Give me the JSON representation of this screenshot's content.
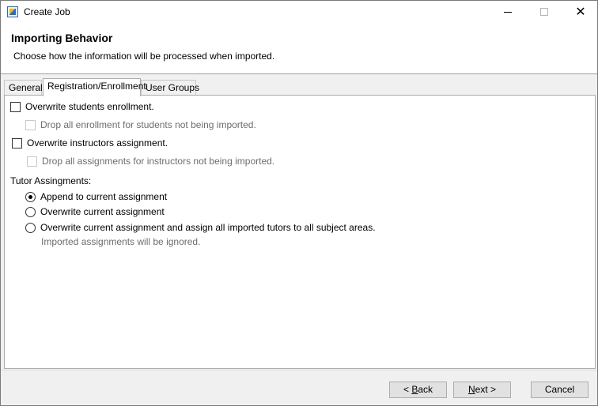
{
  "window": {
    "title": "Create Job",
    "app_icon": "report-wizard-icon",
    "controls": {
      "minimize": "minimize-icon",
      "maximize": "maximize-icon",
      "close": "close-icon",
      "close_glyph": "✕"
    }
  },
  "header": {
    "title": "Importing Behavior",
    "description": "Choose how the information will be processed when imported."
  },
  "tabs": [
    {
      "label": "General",
      "active": false
    },
    {
      "label": "Registration/Enrollment",
      "active": true
    },
    {
      "label": "User Groups",
      "active": false
    }
  ],
  "panel": {
    "overwrite_enrollment": {
      "label": "Overwrite students enrollment.",
      "checked": false
    },
    "drop_enrollment": {
      "label": "Drop all enrollment for students not being imported.",
      "checked": false,
      "enabled": false
    },
    "overwrite_instructors": {
      "label": "Overwrite instructors assignment.",
      "checked": false
    },
    "drop_assignments": {
      "label": "Drop all assignments for instructors not being imported.",
      "checked": false,
      "enabled": false
    },
    "tutor_group_label": "Tutor Assingments:",
    "tutor_options": [
      {
        "label": "Append to current assignment",
        "selected": true
      },
      {
        "label": "Overwrite current assignment",
        "selected": false
      },
      {
        "label": "Overwrite current assignment and assign all imported tutors to all subject areas.",
        "selected": false
      }
    ],
    "tutor_note": "Imported assignments will be ignored."
  },
  "footer": {
    "back_prefix": "< ",
    "back_mnemonic": "B",
    "back_rest": "ack",
    "next_mnemonic": "N",
    "next_rest": "ext >",
    "cancel_label": "Cancel"
  }
}
